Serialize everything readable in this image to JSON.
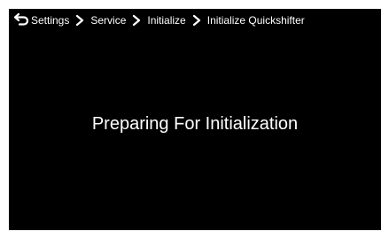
{
  "header": {
    "back_icon": "back-arrow-icon",
    "breadcrumbs": [
      {
        "label": "Settings"
      },
      {
        "label": "Service"
      },
      {
        "label": "Initialize"
      },
      {
        "label": "Initialize Quickshifter"
      }
    ],
    "separator_icon": "chevron-right-icon"
  },
  "main": {
    "message": "Preparing For Initialization"
  },
  "colors": {
    "background": "#000000",
    "text": "#ffffff",
    "frame": "#ffffff"
  }
}
